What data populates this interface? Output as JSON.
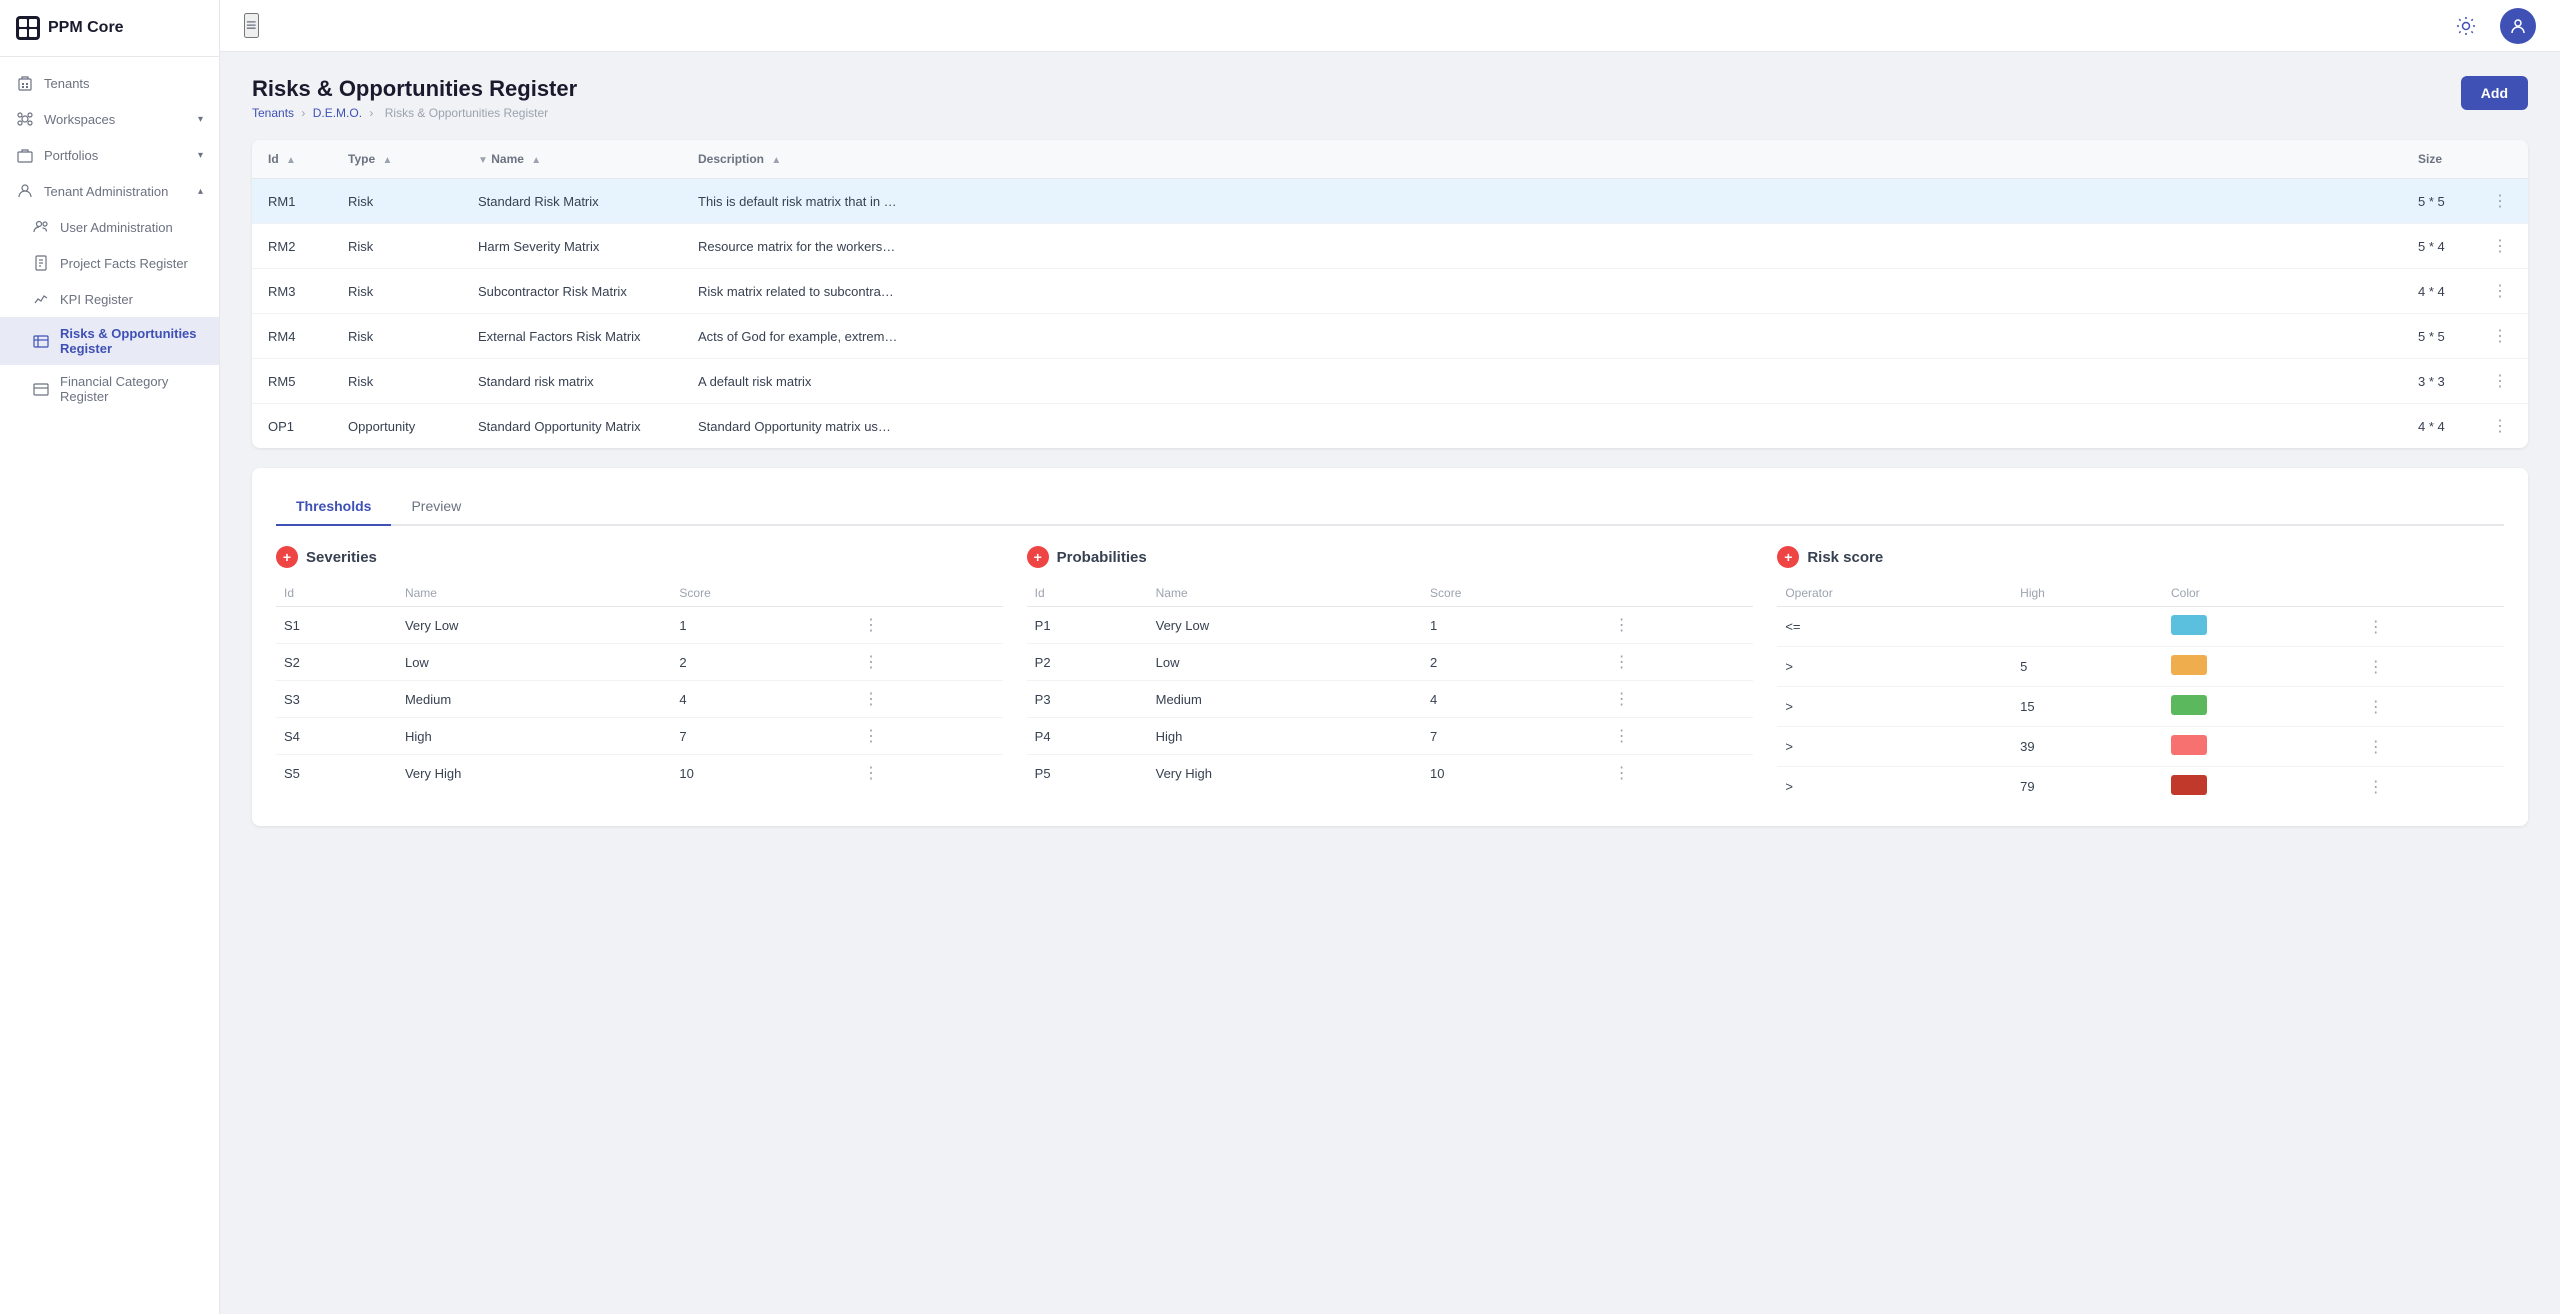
{
  "app": {
    "logo_text": "PPM Core",
    "logo_char": "P"
  },
  "sidebar": {
    "items": [
      {
        "id": "tenants",
        "label": "Tenants",
        "icon": "building-icon",
        "active": false,
        "indent": 0
      },
      {
        "id": "workspaces",
        "label": "Workspaces",
        "icon": "workspaces-icon",
        "active": false,
        "indent": 0,
        "has_chevron": true
      },
      {
        "id": "portfolios",
        "label": "Portfolios",
        "icon": "portfolio-icon",
        "active": false,
        "indent": 0,
        "has_chevron": true
      },
      {
        "id": "tenant-admin",
        "label": "Tenant Administration",
        "icon": "admin-icon",
        "active": false,
        "indent": 0,
        "has_chevron": true,
        "expanded": true
      },
      {
        "id": "user-admin",
        "label": "User Administration",
        "icon": "users-icon",
        "active": false,
        "indent": 1
      },
      {
        "id": "project-facts",
        "label": "Project Facts Register",
        "icon": "facts-icon",
        "active": false,
        "indent": 1
      },
      {
        "id": "kpi-register",
        "label": "KPI Register",
        "icon": "kpi-icon",
        "active": false,
        "indent": 1
      },
      {
        "id": "risks-register",
        "label": "Risks & Opportunities Register",
        "icon": "risks-icon",
        "active": true,
        "indent": 1
      },
      {
        "id": "financial-category",
        "label": "Financial Category Register",
        "icon": "financial-icon",
        "active": false,
        "indent": 1
      }
    ]
  },
  "header": {
    "hamburger_label": "≡"
  },
  "page": {
    "title": "Risks & Opportunities Register",
    "breadcrumb": {
      "parts": [
        "Tenants",
        "D.E.M.O.",
        "Risks & Opportunities Register"
      ]
    },
    "add_button": "Add"
  },
  "table": {
    "columns": [
      {
        "key": "id",
        "label": "Id",
        "sortable": true
      },
      {
        "key": "type",
        "label": "Type",
        "sortable": true
      },
      {
        "key": "name",
        "label": "Name",
        "sortable": true,
        "filtered": true
      },
      {
        "key": "description",
        "label": "Description",
        "sortable": true
      },
      {
        "key": "size",
        "label": "Size",
        "sortable": false
      }
    ],
    "rows": [
      {
        "id": "RM1",
        "type": "Risk",
        "name": "Standard Risk Matrix",
        "description": "This is default risk matrix that in our projects",
        "size": "5 * 5",
        "selected": true
      },
      {
        "id": "RM2",
        "type": "Risk",
        "name": "Harm Severity Matrix",
        "description": "Resource matrix for the workers on the const",
        "size": "5 * 4",
        "selected": false
      },
      {
        "id": "RM3",
        "type": "Risk",
        "name": "Subcontractor Risk Matrix",
        "description": "Risk matrix related to subcontractor issues",
        "size": "4 * 4",
        "selected": false
      },
      {
        "id": "RM4",
        "type": "Risk",
        "name": "External Factors Risk Matrix",
        "description": "Acts of God for example, extreme weather, le",
        "size": "5 * 5",
        "selected": false
      },
      {
        "id": "RM5",
        "type": "Risk",
        "name": "Standard risk matrix",
        "description": "A default risk matrix",
        "size": "3 * 3",
        "selected": false
      },
      {
        "id": "OP1",
        "type": "Opportunity",
        "name": "Standard Opportunity Matrix",
        "description": "Standard Opportunity matrix used in all proj",
        "size": "4 * 4",
        "selected": false
      }
    ]
  },
  "tabs": [
    {
      "id": "thresholds",
      "label": "Thresholds",
      "active": true
    },
    {
      "id": "preview",
      "label": "Preview",
      "active": false
    }
  ],
  "thresholds": {
    "severities": {
      "title": "Severities",
      "columns": [
        "Id",
        "Name",
        "Score"
      ],
      "rows": [
        {
          "id": "S1",
          "name": "Very Low",
          "score": "1"
        },
        {
          "id": "S2",
          "name": "Low",
          "score": "2"
        },
        {
          "id": "S3",
          "name": "Medium",
          "score": "4"
        },
        {
          "id": "S4",
          "name": "High",
          "score": "7"
        },
        {
          "id": "S5",
          "name": "Very High",
          "score": "10"
        }
      ]
    },
    "probabilities": {
      "title": "Probabilities",
      "columns": [
        "Id",
        "Name",
        "Score"
      ],
      "rows": [
        {
          "id": "P1",
          "name": "Very Low",
          "score": "1"
        },
        {
          "id": "P2",
          "name": "Low",
          "score": "2"
        },
        {
          "id": "P3",
          "name": "Medium",
          "score": "4"
        },
        {
          "id": "P4",
          "name": "High",
          "score": "7"
        },
        {
          "id": "P5",
          "name": "Very High",
          "score": "10"
        }
      ]
    },
    "risk_score": {
      "title": "Risk score",
      "columns": [
        "Operator",
        "High",
        "Color"
      ],
      "rows": [
        {
          "operator": "<=",
          "high": "",
          "color": "#5bc0de"
        },
        {
          "operator": ">",
          "high": "5",
          "color": "#f0ad4e"
        },
        {
          "operator": ">",
          "high": "15",
          "color": "#5cb85c"
        },
        {
          "operator": ">",
          "high": "39",
          "color": "#f87171"
        },
        {
          "operator": ">",
          "high": "79",
          "color": "#c0392b"
        }
      ]
    }
  }
}
